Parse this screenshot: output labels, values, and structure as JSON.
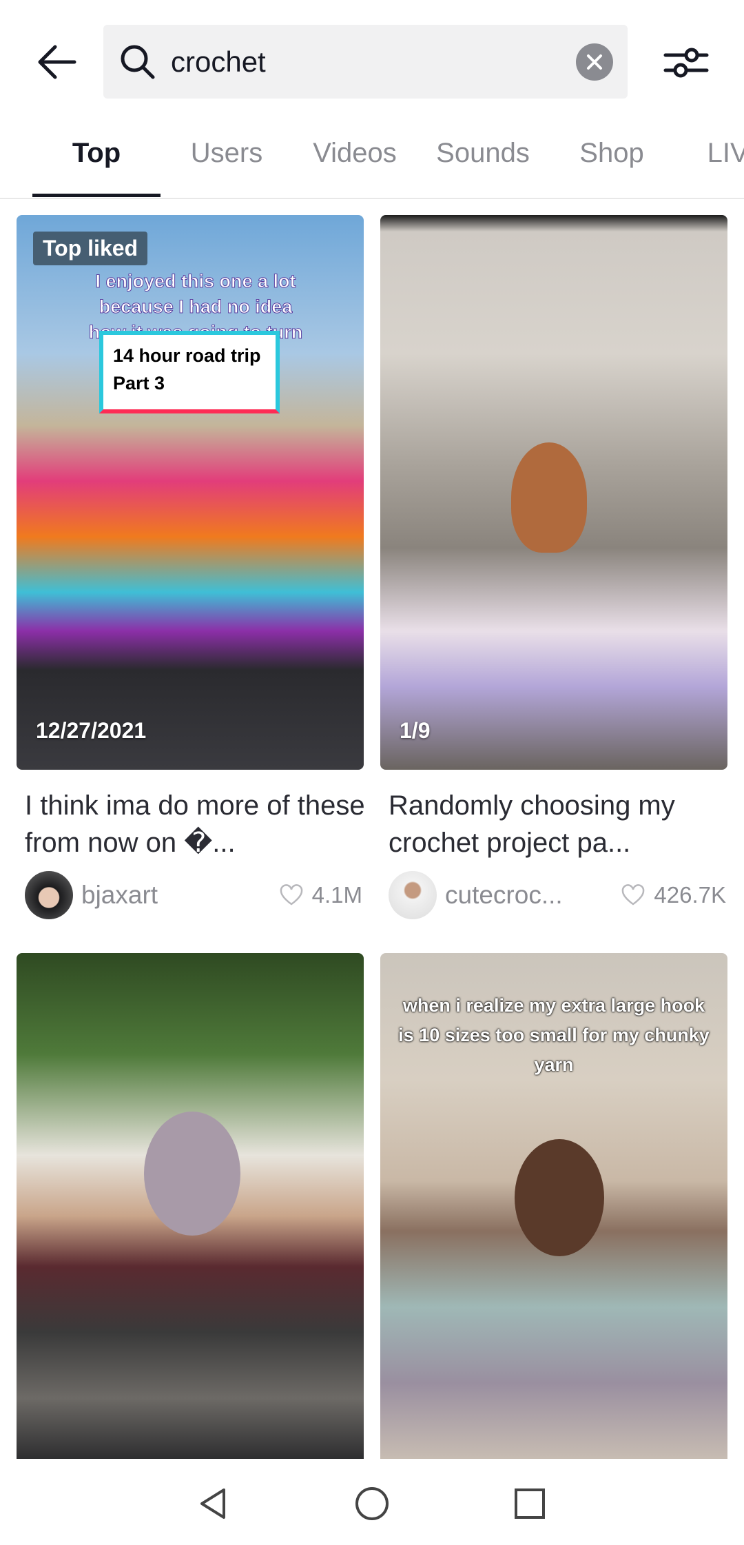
{
  "header": {
    "search_value": "crochet"
  },
  "tabs": [
    {
      "label": "Top"
    },
    {
      "label": "Users"
    },
    {
      "label": "Videos"
    },
    {
      "label": "Sounds"
    },
    {
      "label": "Shop"
    },
    {
      "label": "LIVE"
    }
  ],
  "active_tab": "Top",
  "results": [
    {
      "badge": "Top liked",
      "overlay_text": "I enjoyed this one a lot because I had no idea how it was going to turn",
      "sticker_line1": "14 hour road trip",
      "sticker_line2": "Part 3",
      "corner_label": "12/27/2021",
      "caption": "I think ima do more of these from now on �...",
      "username": "bjaxart",
      "likes": "4.1M"
    },
    {
      "corner_label": "1/9",
      "caption": "Randomly choosing my crochet project pa...",
      "username": "cutecroc...",
      "likes": "426.7K"
    },
    {},
    {
      "overlay_text": "when i realize my extra large hook is 10 sizes too small for my chunky yarn"
    }
  ]
}
